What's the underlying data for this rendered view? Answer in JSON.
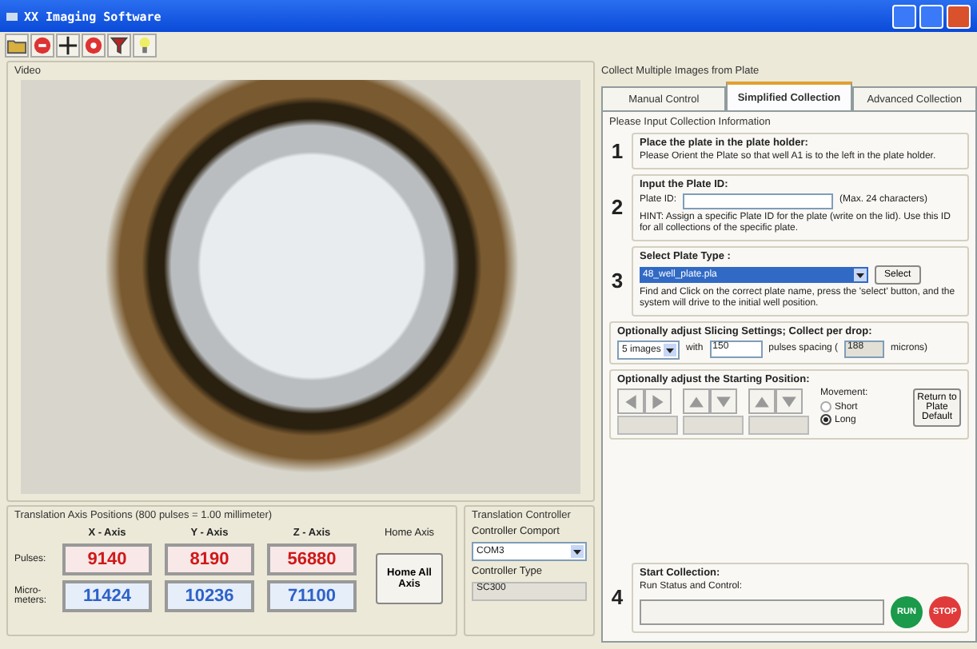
{
  "window": {
    "title": "XX Imaging Software"
  },
  "video": {
    "label": "Video"
  },
  "axis_positions": {
    "title": "Translation Axis Positions (800 pulses = 1.00 millimeter)",
    "columns": [
      "X - Axis",
      "Y - Axis",
      "Z - Axis"
    ],
    "row_labels": [
      "Pulses:",
      "Micro-meters:"
    ],
    "pulses": [
      "9140",
      "8190",
      "56880"
    ],
    "micrometers": [
      "11424",
      "10236",
      "71100"
    ],
    "home_label": "Home Axis",
    "home_button": "Home All Axis"
  },
  "controller": {
    "title": "Translation Controller",
    "comport_label": "Controller Comport",
    "comport_value": "COM3",
    "type_label": "Controller Type",
    "type_value": "SC300"
  },
  "collection": {
    "title": "Collect Multiple Images from Plate",
    "tabs": [
      {
        "label": "Manual Control",
        "selected": false
      },
      {
        "label": "Simplified Collection",
        "selected": true
      },
      {
        "label": "Advanced Collection",
        "selected": false
      }
    ],
    "group_title": "Please Input Collection Information",
    "step1": {
      "number": "1",
      "title": "Place the plate  in the plate holder:",
      "text": "Please Orient the Plate so that well A1 is to the left in the plate holder."
    },
    "step2": {
      "number": "2",
      "title": "Input the Plate ID:",
      "field_label": "Plate ID:",
      "max_note": "(Max. 24 characters)",
      "hint": "HINT: Assign a specific Plate ID for the plate (write on the lid). Use this ID for all collections of the specific plate."
    },
    "step3": {
      "number": "3",
      "title": "Select Plate Type :",
      "plate_value": "48_well_plate.pla",
      "select_button": "Select",
      "text": "Find and Click on the correct plate name, press the 'select' button, and the system will drive to the initial well position."
    },
    "slicing": {
      "title": "Optionally adjust Slicing Settings; Collect per drop:",
      "images_value": "5 images",
      "with_label": "with",
      "pulses_value": "150",
      "spacing_label": "pulses spacing  (",
      "microns_value": "188",
      "microns_label": "microns)"
    },
    "starting": {
      "title": "Optionally adjust the Starting Position:",
      "movement_label": "Movement:",
      "movement": [
        {
          "label": "Short",
          "selected": false
        },
        {
          "label": "Long",
          "selected": true
        }
      ],
      "return_button": "Return to Plate Default"
    },
    "step4": {
      "number": "4",
      "title": "Start Collection:",
      "status_label": "Run Status and Control:",
      "run_button": "RUN",
      "stop_button": "STOP"
    }
  }
}
